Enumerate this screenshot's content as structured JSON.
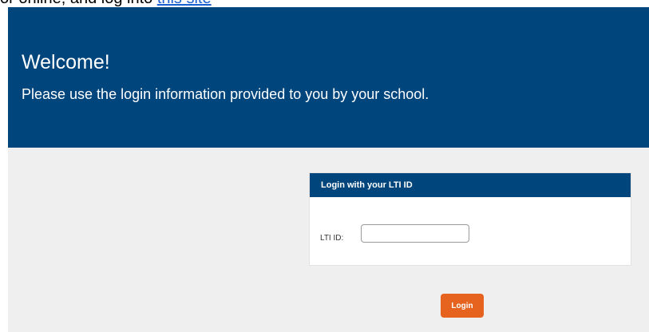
{
  "top_cutoff": {
    "text": "or online, and log into ",
    "link": "this site"
  },
  "hero": {
    "title": "Welcome!",
    "subtitle": "Please use the login information provided to you by your school."
  },
  "login": {
    "header": "Login with your LTI ID",
    "field_label": "LTI ID:",
    "field_value": "",
    "button_label": "Login"
  },
  "colors": {
    "brand_blue": "#00457c",
    "button_orange": "#e5631e",
    "page_background": "#efefef"
  }
}
